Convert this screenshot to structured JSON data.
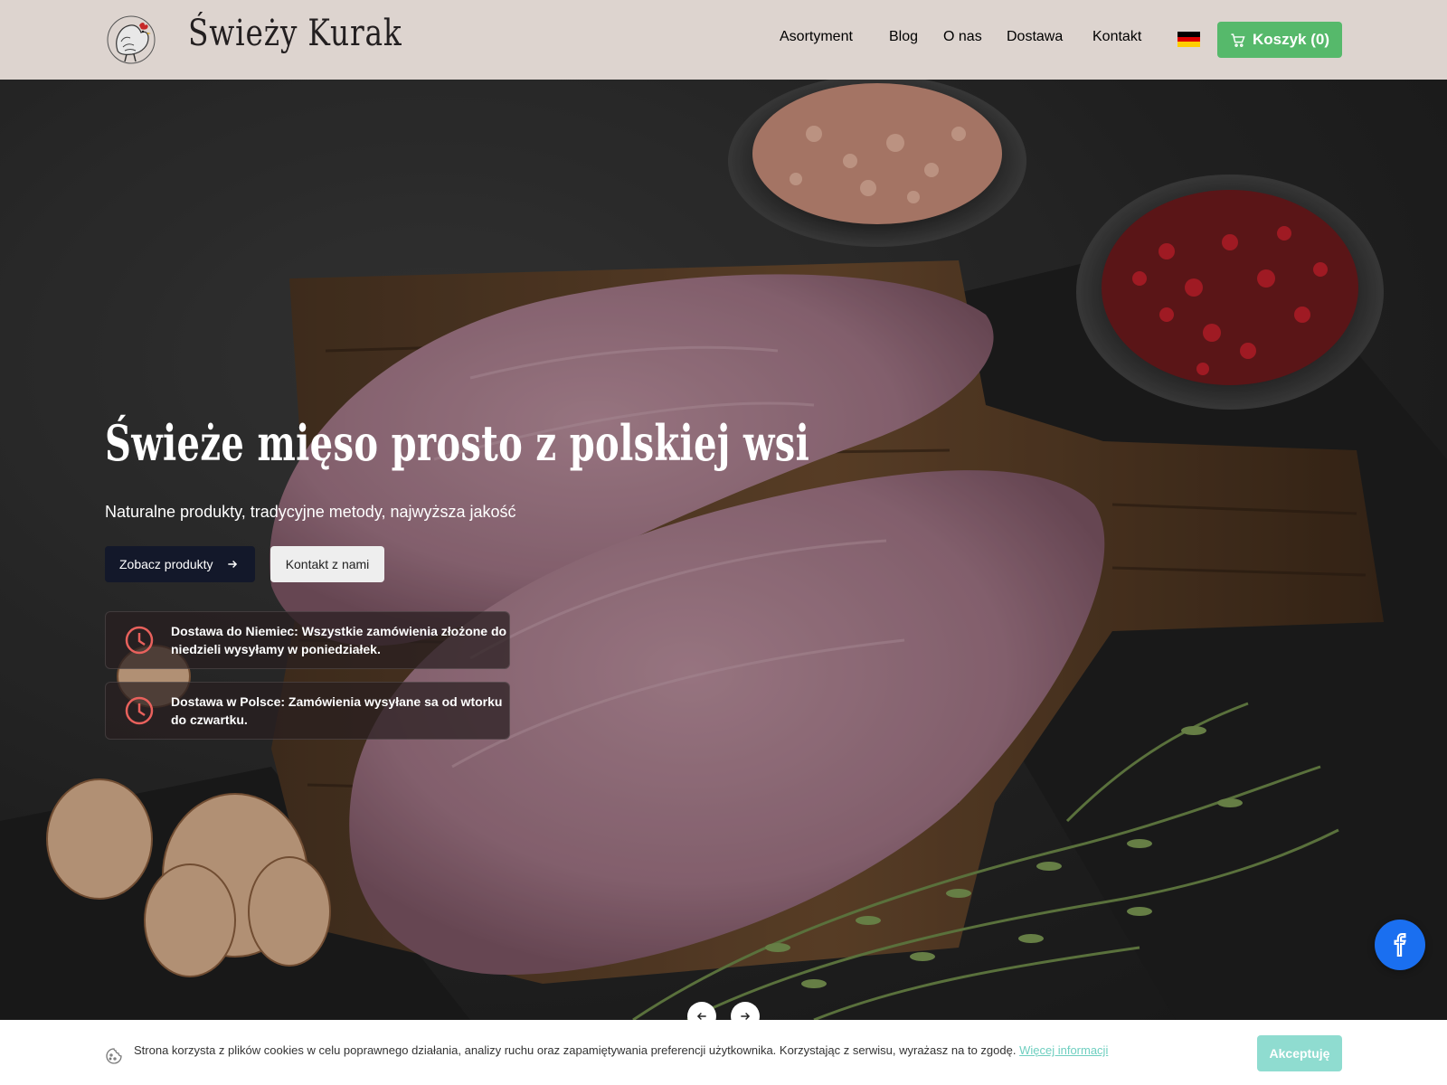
{
  "header": {
    "brand": "Świeży Kurak",
    "nav": [
      {
        "label": "Asortyment"
      },
      {
        "label": "Blog"
      },
      {
        "label": "O nas"
      },
      {
        "label": "Dostawa"
      },
      {
        "label": "Kontakt"
      }
    ],
    "language_flag": "de-flag-icon",
    "cart_label": "Koszyk (0)",
    "colors": {
      "cart_bg": "#56b96b",
      "header_bg": "#ddd4cf",
      "nav_text": "#6b5a52"
    }
  },
  "hero": {
    "title": "Świeże mięso prosto z polskiej wsi",
    "subtitle": "Naturalne produkty, tradycyjne metody, najwyższa jakość",
    "primary_button": "Zobacz produkty",
    "secondary_button": "Kontakt z nami",
    "notices": [
      {
        "text": "Dostawa do Niemiec: Wszystkie zamówienia złożone do niedzieli wysyłamy w poniedziałek.",
        "icon": "clock-icon"
      },
      {
        "text": "Dostawa w Polsce: Zamówienia wysyłane sa od wtorku do czwartku.",
        "icon": "clock-icon"
      }
    ],
    "colors": {
      "primary_button_bg": "#13182a",
      "notice_icon": "#e8615c"
    }
  },
  "cookie": {
    "text": "Strona korzysta z plików cookies w celu poprawnego działania, analizy ruchu oraz zapamiętywania preferencji użytkownika. Korzystając z serwisu, wyrażasz na to zgodę.",
    "link": "Więcej informacji",
    "accept": "Akceptuję",
    "colors": {
      "accept_bg": "#8fdcd0",
      "link": "#6fcfc0"
    }
  },
  "social": {
    "facebook_icon": "facebook-icon",
    "color": "#1a6ff0"
  }
}
